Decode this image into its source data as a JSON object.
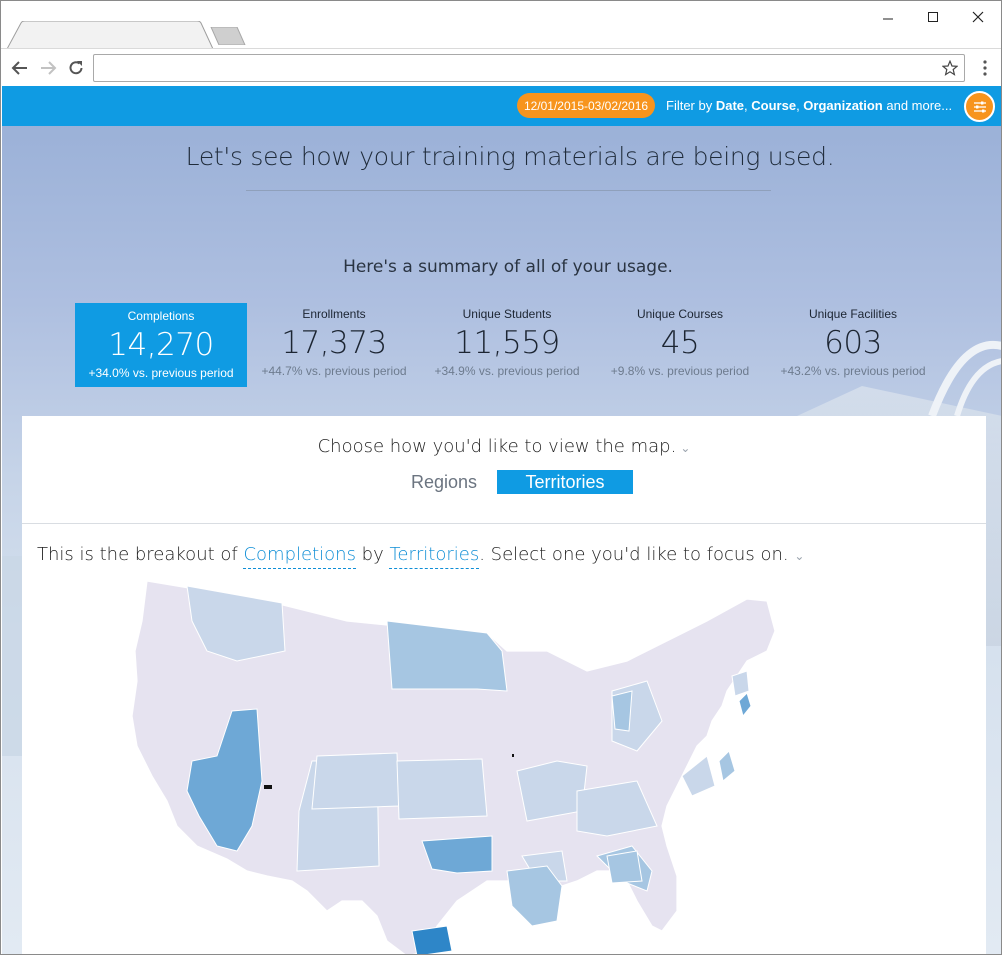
{
  "browser": {
    "url": ""
  },
  "filter_bar": {
    "date_range": "12/01/2015-03/02/2016",
    "prefix": "Filter by ",
    "field_date": "Date",
    "sep1": ", ",
    "field_course": "Course",
    "sep2": ", ",
    "field_org": "Organization",
    "suffix": " and more..."
  },
  "headline": "Let's see how your training materials are being used.",
  "summary_title": "Here's a summary of all of your usage.",
  "stats": [
    {
      "label": "Completions",
      "value": "14,270",
      "delta": "+34.0% vs. previous period",
      "active": true
    },
    {
      "label": "Enrollments",
      "value": "17,373",
      "delta": "+44.7% vs. previous period",
      "active": false
    },
    {
      "label": "Unique Students",
      "value": "11,559",
      "delta": "+34.9% vs. previous period",
      "active": false
    },
    {
      "label": "Unique Courses",
      "value": "45",
      "delta": "+9.8% vs. previous period",
      "active": false
    },
    {
      "label": "Unique Facilities",
      "value": "603",
      "delta": "+43.2% vs. previous period",
      "active": false
    }
  ],
  "map_view": {
    "prompt": "Choose how you'd like to view the map.",
    "tabs": [
      {
        "label": "Regions",
        "selected": false
      },
      {
        "label": "Territories",
        "selected": true
      }
    ]
  },
  "breakout": {
    "prefix": "This is the breakout of ",
    "metric": "Completions",
    "by": " by ",
    "dimension": "Territories",
    "suffix": ". Select one you'd like to focus on."
  },
  "colors": {
    "accent": "#0f9be3",
    "orange": "#f7941d",
    "map_base": "#e6e3f0",
    "map_light": "#c9d7ea",
    "map_mid": "#a6c6e2",
    "map_strong": "#6ea8d6",
    "map_max": "#2e86c8"
  }
}
